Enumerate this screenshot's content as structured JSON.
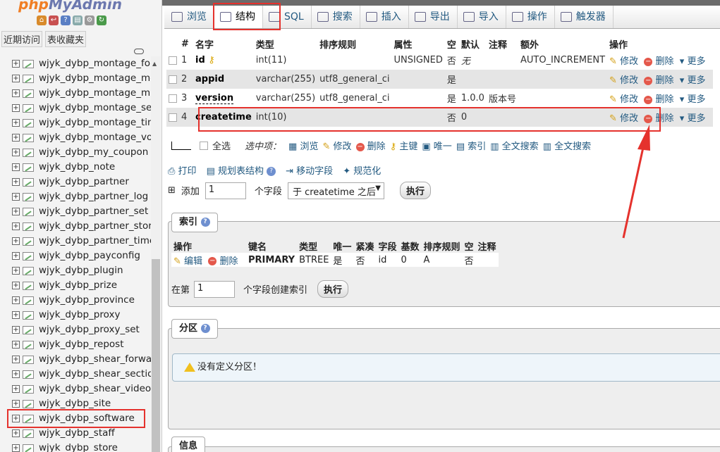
{
  "left": {
    "logo_main": "php",
    "logo_accent": "MyAdmin",
    "tabs": [
      "近期访问",
      "表收藏夹"
    ],
    "tables": [
      "wjyk_dybp_montage_folc",
      "wjyk_dybp_montage_med",
      "wjyk_dybp_montage_mus",
      "wjyk_dybp_montage_set",
      "wjyk_dybp_montage_tim",
      "wjyk_dybp_montage_voic",
      "wjyk_dybp_my_coupon",
      "wjyk_dybp_note",
      "wjyk_dybp_partner",
      "wjyk_dybp_partner_log",
      "wjyk_dybp_partner_set",
      "wjyk_dybp_partner_store",
      "wjyk_dybp_partner_time",
      "wjyk_dybp_payconfig",
      "wjyk_dybp_plugin",
      "wjyk_dybp_prize",
      "wjyk_dybp_province",
      "wjyk_dybp_proxy",
      "wjyk_dybp_proxy_set",
      "wjyk_dybp_repost",
      "wjyk_dybp_shear_forward",
      "wjyk_dybp_shear_section",
      "wjyk_dybp_shear_video",
      "wjyk_dybp_site",
      "wjyk_dybp_software",
      "wjyk_dybp_staff",
      "wjyk_dybp_store"
    ],
    "selected": "wjyk_dybp_software"
  },
  "tabs": [
    {
      "label": "浏览",
      "icon": "browse-icon"
    },
    {
      "label": "结构",
      "icon": "structure-icon",
      "active": true
    },
    {
      "label": "SQL",
      "icon": "sql-icon"
    },
    {
      "label": "搜索",
      "icon": "search-icon"
    },
    {
      "label": "插入",
      "icon": "insert-icon"
    },
    {
      "label": "导出",
      "icon": "export-icon"
    },
    {
      "label": "导入",
      "icon": "import-icon"
    },
    {
      "label": "操作",
      "icon": "wrench-icon"
    },
    {
      "label": "触发器",
      "icon": "trigger-icon"
    }
  ],
  "structure": {
    "headers": [
      "#",
      "名字",
      "类型",
      "排序规则",
      "属性",
      "空",
      "默认",
      "注释",
      "额外",
      "操作"
    ],
    "rows": [
      {
        "num": "1",
        "name": "id",
        "type": "int(11)",
        "collation": "",
        "attr": "UNSIGNED",
        "null": "否",
        "default": "无",
        "comment": "",
        "extra": "AUTO_INCREMENT"
      },
      {
        "num": "2",
        "name": "appid",
        "type": "varchar(255)",
        "collation": "utf8_general_ci",
        "attr": "",
        "null": "是",
        "default": "",
        "comment": "",
        "extra": ""
      },
      {
        "num": "3",
        "name": "version",
        "type": "varchar(255)",
        "collation": "utf8_general_ci",
        "attr": "",
        "null": "是",
        "default": "1.0.0",
        "comment": "版本号",
        "extra": ""
      },
      {
        "num": "4",
        "name": "createtime",
        "type": "int(10)",
        "collation": "",
        "attr": "",
        "null": "否",
        "default": "0",
        "comment": "",
        "extra": ""
      }
    ],
    "actions": {
      "edit": "修改",
      "delete": "删除",
      "more": "更多"
    }
  },
  "actionbar": {
    "select_all": "全选",
    "selected_label": "选中项：",
    "items": [
      "浏览",
      "修改",
      "删除",
      "主键",
      "唯一",
      "索引",
      "全文搜索",
      "全文搜索"
    ]
  },
  "toolbar2": {
    "print": "打印",
    "plan": "规划表结构",
    "move": "移动字段",
    "normalize": "规范化"
  },
  "addrow": {
    "add": "添加",
    "count": "1",
    "fields_label": "个字段",
    "position": "于 createtime 之后",
    "go": "执行"
  },
  "index": {
    "legend": "索引",
    "headers": [
      "操作",
      "键名",
      "类型",
      "唯一",
      "紧凑",
      "字段",
      "基数",
      "排序规则",
      "空",
      "注释"
    ],
    "row": {
      "edit": "编辑",
      "delete": "删除",
      "key": "PRIMARY",
      "type": "BTREE",
      "unique": "是",
      "packed": "否",
      "column": "id",
      "cardinality": "0",
      "collation": "A",
      "null": "否",
      "comment": ""
    },
    "create_prefix": "在第",
    "create_count": "1",
    "create_suffix": "个字段创建索引",
    "go": "执行"
  },
  "partition": {
    "legend": "分区",
    "message": "没有定义分区！"
  },
  "info": {
    "legend": "信息"
  },
  "colors": {
    "link": "#235a81",
    "highlight": "#e5322d",
    "row_alt": "#e5e5e5"
  }
}
